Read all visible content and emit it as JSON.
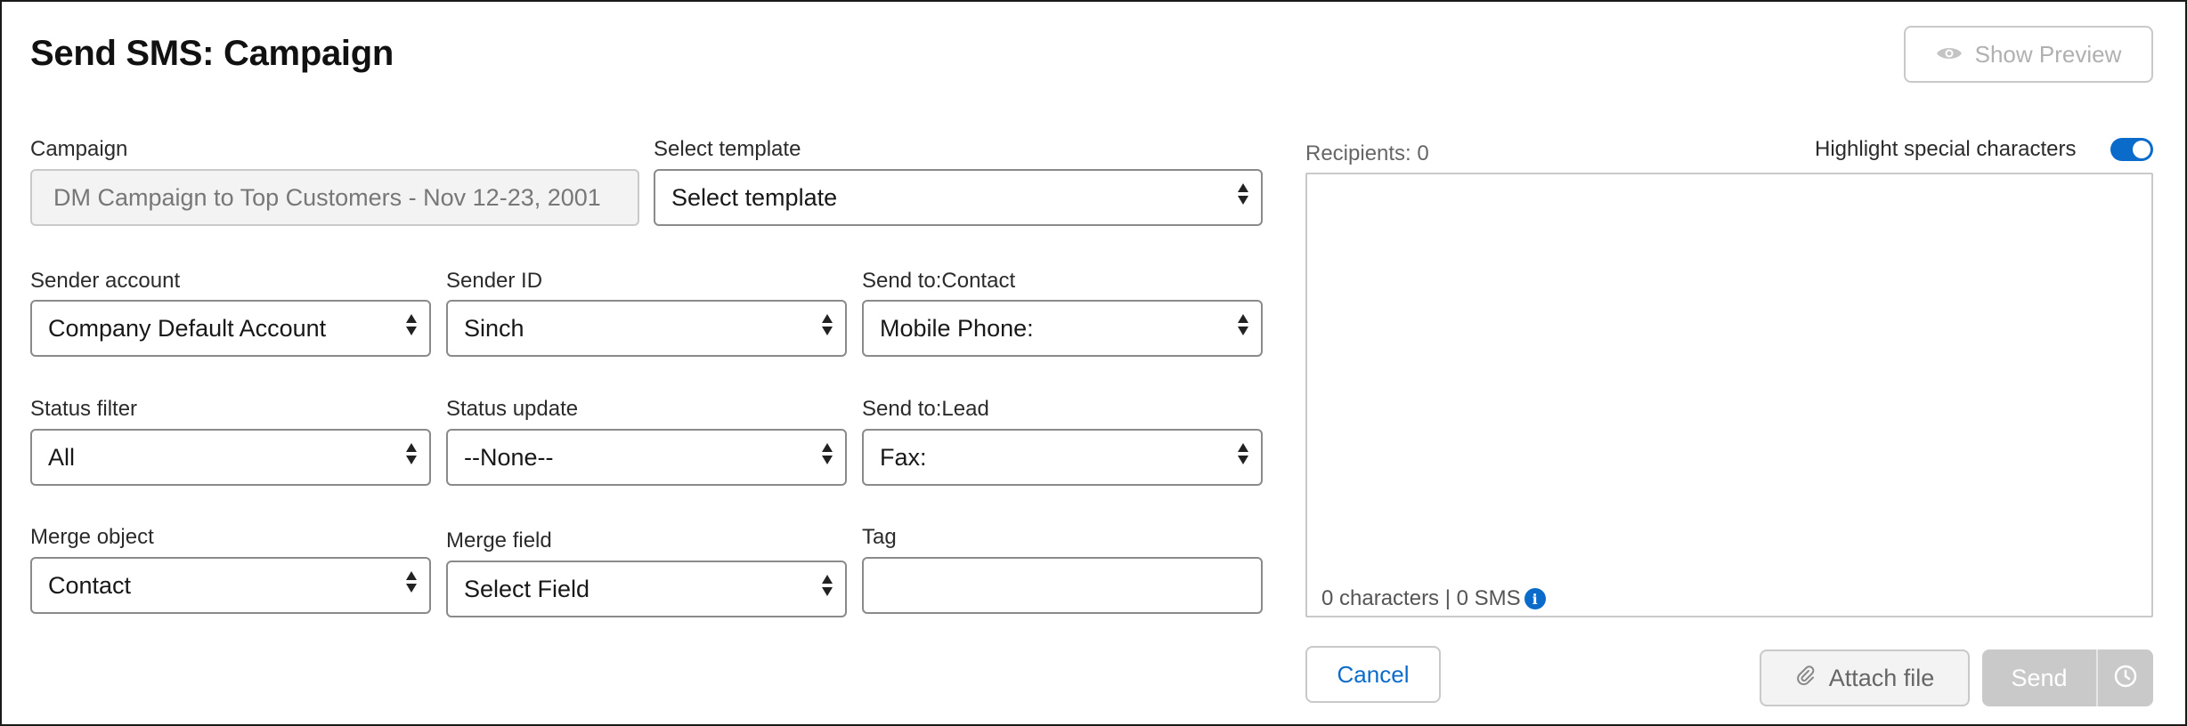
{
  "header": {
    "title": "Send SMS: Campaign",
    "preview_label": "Show Preview",
    "preview_icon": "eye-icon"
  },
  "form": {
    "campaign": {
      "label": "Campaign",
      "value": "DM Campaign to Top Customers - Nov 12-23, 2001"
    },
    "template": {
      "label": "Select template",
      "value": "Select template"
    },
    "sender_account": {
      "label": "Sender account",
      "value": "Company Default Account"
    },
    "sender_id": {
      "label": "Sender ID",
      "value": "Sinch"
    },
    "send_to_contact": {
      "label": "Send to:Contact",
      "value": "Mobile Phone:"
    },
    "status_filter": {
      "label": "Status filter",
      "value": "All"
    },
    "status_update": {
      "label": "Status update",
      "value": "--None--"
    },
    "send_to_lead": {
      "label": "Send to:Lead",
      "value": "Fax:"
    },
    "merge_object": {
      "label": "Merge object",
      "value": "Contact"
    },
    "merge_field": {
      "label": "Merge field",
      "value": "Select Field"
    },
    "tag": {
      "label": "Tag",
      "value": ""
    }
  },
  "message": {
    "recipients": "Recipients: 0",
    "highlight_label": "Highlight special characters",
    "highlight_enabled": true,
    "counter": "0 characters | 0 SMS",
    "info_icon_glyph": "i",
    "body": ""
  },
  "actions": {
    "cancel": "Cancel",
    "attach": "Attach file",
    "attach_icon": "paperclip-icon",
    "send": "Send",
    "schedule_icon": "clock-icon"
  },
  "colors": {
    "accent": "#0b6bcb",
    "disabled": "#c9c9c9"
  }
}
